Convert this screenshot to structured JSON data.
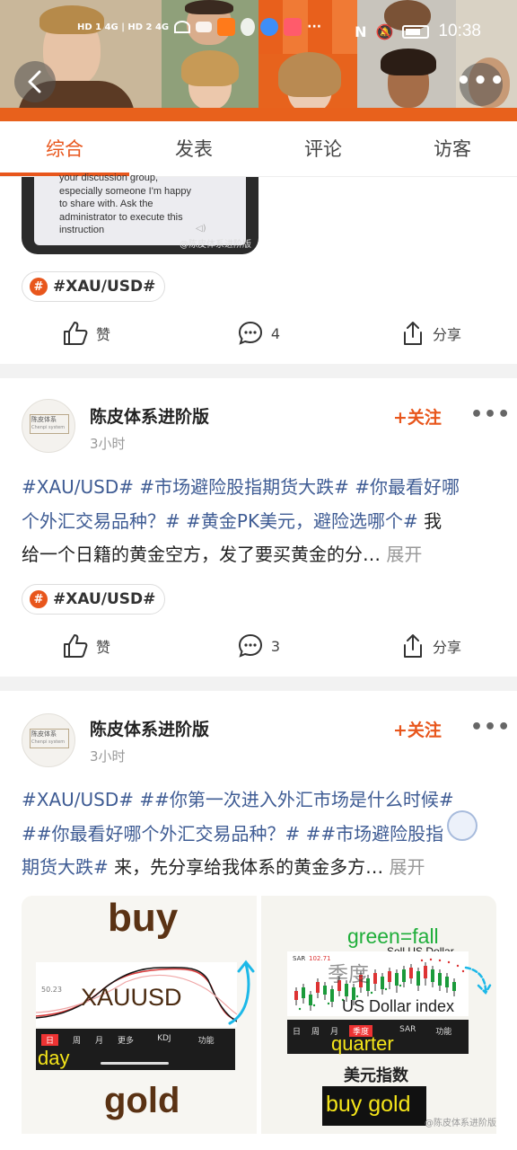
{
  "status_bar": {
    "network_left": "HD 1 4G | HD 2 4G",
    "time": "10:38"
  },
  "tabs": [
    {
      "label": "综合",
      "active": true
    },
    {
      "label": "发表",
      "active": false
    },
    {
      "label": "评论",
      "active": false
    },
    {
      "label": "访客",
      "active": false
    }
  ],
  "post1": {
    "screenshot_text": "your discussion group, especially someone I'm happy to share with. Ask the administrator to execute this instruction",
    "watermark": "@陈皮体系进阶版",
    "tag": "#XAU/USD#",
    "like_label": "赞",
    "comment_count": "4",
    "share_label": "分享"
  },
  "post2": {
    "author": "陈皮体系进阶版",
    "time": "3小时",
    "follow_label": "+关注",
    "avatar_text": "陈皮体系",
    "avatar_subtext": "Chenpi system",
    "line1": [
      "#XAU/USD#",
      " ",
      "#市场避险股指期货大跌#",
      " ",
      "#你最看好哪"
    ],
    "line2": [
      "个外汇交易品种？#",
      " ",
      "#黄金PK美元，避险选哪个#",
      " 我"
    ],
    "line3": "给一个日籍的黄金空方，发了要买黄金的分…",
    "expand_label": "展开",
    "tag": "#XAU/USD#",
    "like_label": "赞",
    "comment_count": "3",
    "share_label": "分享"
  },
  "post3": {
    "author": "陈皮体系进阶版",
    "time": "3小时",
    "follow_label": "+关注",
    "avatar_text": "陈皮体系",
    "avatar_subtext": "Chenpi system",
    "line1": [
      "#XAU/USD#",
      " ",
      "##你第一次进入外汇市场是什么时候#"
    ],
    "line2": [
      "##你最看好哪个外汇交易品种？#",
      " ",
      "##市场避险股指"
    ],
    "line3_ht": "期货大跌#",
    "line3_rest": " 来，先分享给我体系的黄金多方…",
    "expand_label": "展开",
    "image_left": {
      "top_label": "buy",
      "center_label": "XAUUSD",
      "price_label": "50.23",
      "tabs": [
        "日",
        "周",
        "月",
        "更多",
        "KDJ",
        "功能"
      ],
      "day_label": "day",
      "bottom_label": "gold"
    },
    "image_right": {
      "green_label": "green=fall",
      "sell_label": "Sell US Dollar",
      "sar_value": "102.71",
      "sar_label": "SAR",
      "season_label": "季度",
      "index_label": "US Dollar index",
      "tabs": [
        "日",
        "周",
        "月",
        "季度",
        "SAR",
        "功能"
      ],
      "quarter_label": "quarter",
      "cn_label": "美元指数",
      "buy_label": "buy gold",
      "watermark": "@陈皮体系进阶版"
    }
  },
  "colors": {
    "accent": "#e8561c",
    "hashtag": "#3f5c94",
    "muted": "#999999"
  }
}
